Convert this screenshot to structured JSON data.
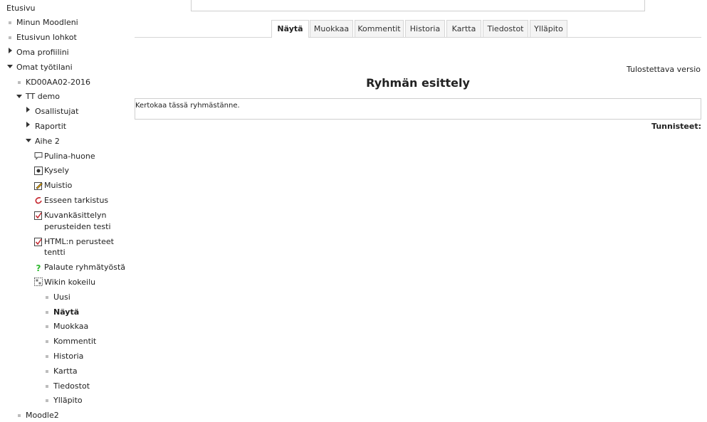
{
  "nav": {
    "home": "Etusivu",
    "my_moodle": "Minun Moodleni",
    "front_blocks": "Etusivun lohkot",
    "profile": "Oma profiilini",
    "workspaces": "Omat työtilani",
    "kd": "KD00AA02-2016",
    "tt_demo": "TT demo",
    "participants": "Osallistujat",
    "reports": "Raportit",
    "topic2": "Aihe 2",
    "activities": [
      {
        "label": "Pulina-huone",
        "icon": "chat-icon"
      },
      {
        "label": "Kysely",
        "icon": "poll-icon"
      },
      {
        "label": "Muistio",
        "icon": "notepad-icon"
      },
      {
        "label": "Esseen tarkistus",
        "icon": "plagiarism-icon"
      },
      {
        "label": "Kuvankäsittelyn",
        "label2": "perusteiden testi",
        "icon": "quiz-icon"
      },
      {
        "label": "HTML:n perusteet",
        "label2": "tentti",
        "icon": "quiz-icon"
      },
      {
        "label": "Palaute ryhmätyöstä",
        "icon": "feedback-icon"
      },
      {
        "label": "Wikin kokeilu",
        "icon": "wiki-icon"
      }
    ],
    "wiki_items": [
      "Uusi",
      "Näytä",
      "Muokkaa",
      "Kommentit",
      "Historia",
      "Kartta",
      "Tiedostot",
      "Ylläpito"
    ],
    "moodle2": "Moodle2"
  },
  "tabs": [
    "Näytä",
    "Muokkaa",
    "Kommentit",
    "Historia",
    "Kartta",
    "Tiedostot",
    "Ylläpito"
  ],
  "print_link": "Tulostettava versio",
  "page_title": "Ryhmän esittely",
  "content": "Kertokaa tässä ryhmästänne.",
  "tags_label": "Tunnisteet:"
}
